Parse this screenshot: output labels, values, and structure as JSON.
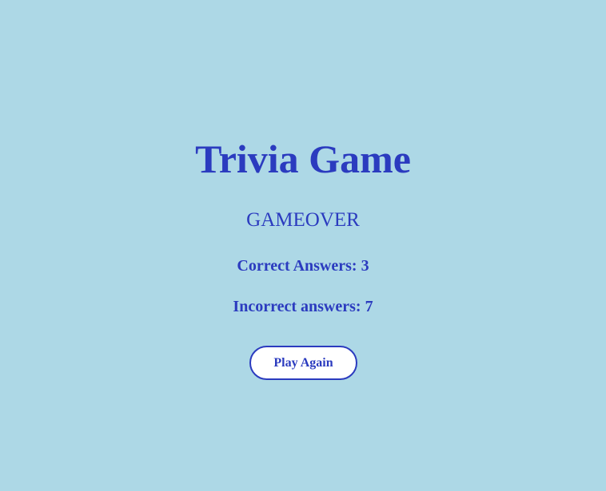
{
  "app": {
    "title": "Trivia Game"
  },
  "result": {
    "status": "GAMEOVER",
    "correct_label": "Correct Answers: ",
    "correct_count": "3",
    "incorrect_label": "Incorrect answers: ",
    "incorrect_count": "7"
  },
  "actions": {
    "play_again_label": "Play Again"
  },
  "colors": {
    "background": "#add8e6",
    "text": "#2b3bbf",
    "button_background": "#ffffff"
  }
}
